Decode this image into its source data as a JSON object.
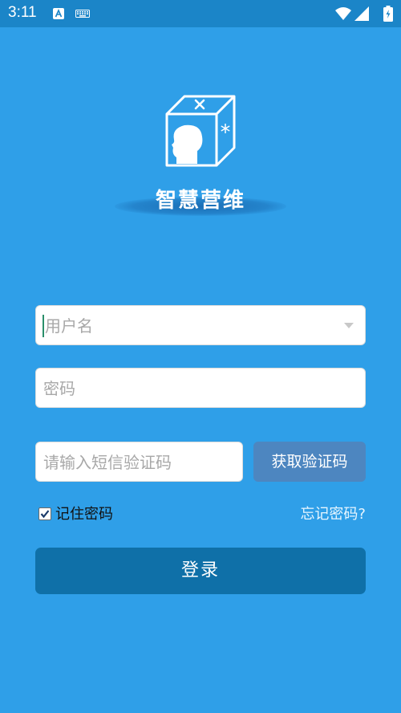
{
  "status_bar": {
    "time": "3:11",
    "icons": [
      "a-notification-icon",
      "keyboard-icon",
      "wifi-icon",
      "signal-icon",
      "battery-icon"
    ]
  },
  "app": {
    "name": "智慧营维",
    "logo_icon": "box-head-logo-icon"
  },
  "form": {
    "username_placeholder": "用户名",
    "password_placeholder": "密码",
    "sms_placeholder": "请输入短信验证码",
    "get_code_label": "获取验证码",
    "remember_label": "记住密码",
    "remember_checked": true,
    "forgot_label": "忘记密码?",
    "login_label": "登录"
  },
  "colors": {
    "background": "#2f9fe8",
    "status_bar": "#1b85c8",
    "get_code_button": "#4d86c0",
    "login_button": "#0f70a8"
  }
}
